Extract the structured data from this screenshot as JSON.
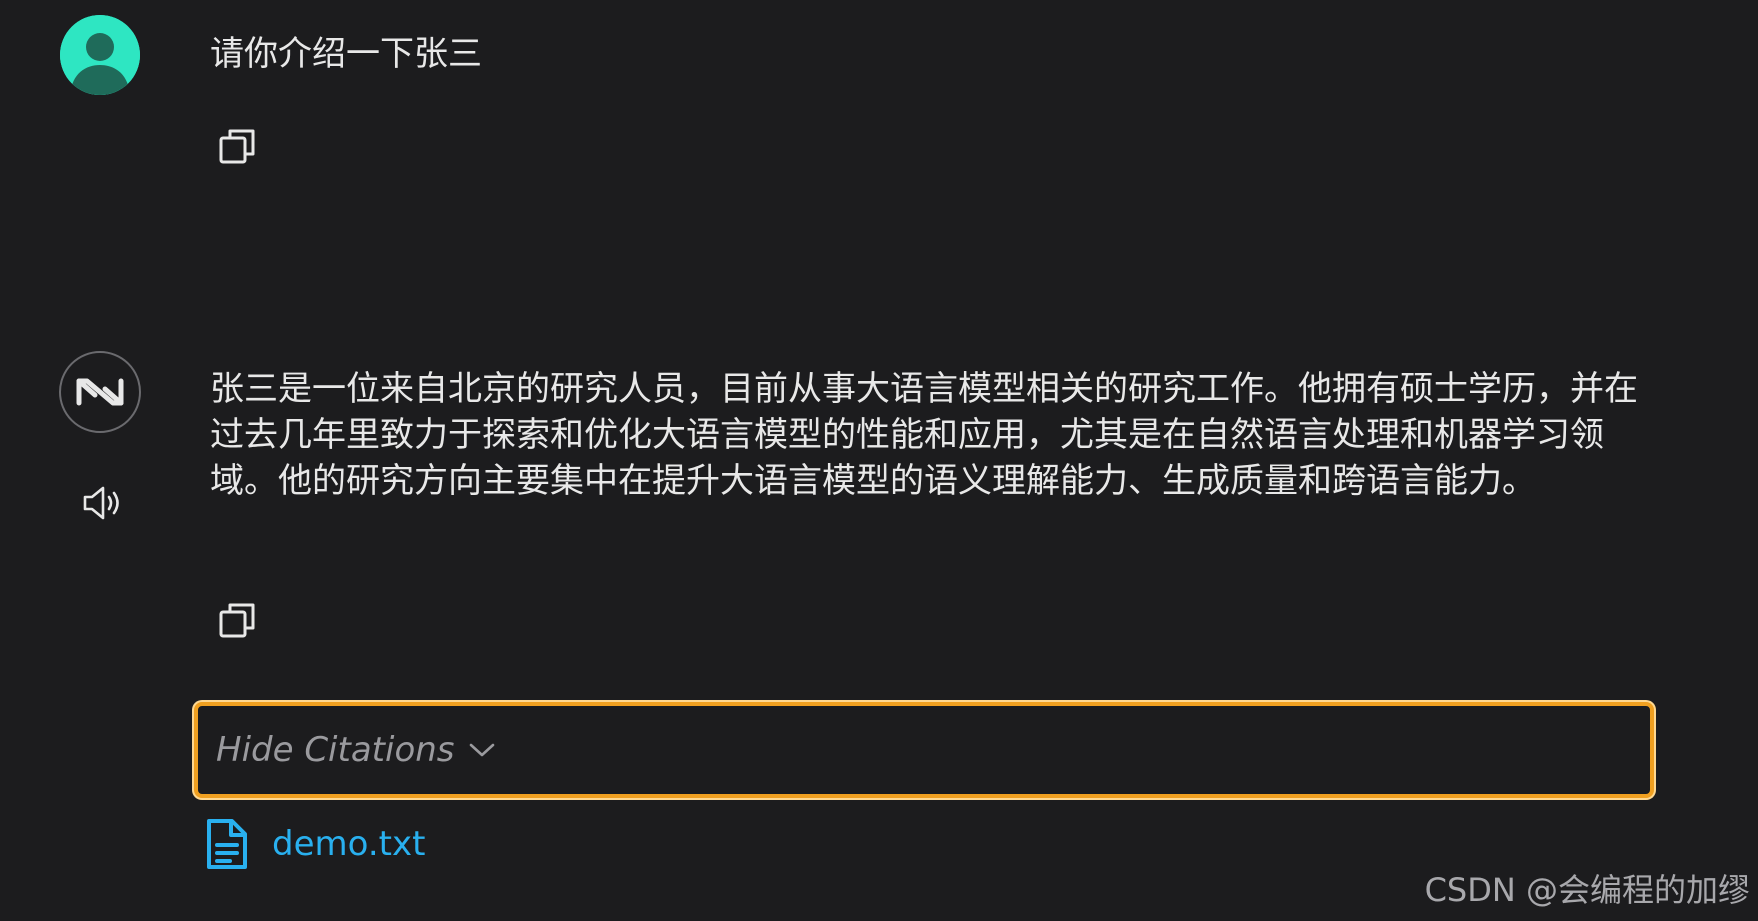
{
  "colors": {
    "background": "#1c1c1e",
    "text": "#e8e8e8",
    "user_avatar": "#2ee6c2",
    "focus_border": "#f0a020",
    "link": "#29b0ef",
    "muted": "#9a9a9e"
  },
  "user_message": {
    "avatar_icon": "user-avatar-icon",
    "text": "请你介绍一下张三",
    "copy_icon": "copy-icon"
  },
  "assistant_message": {
    "avatar_icon": "assistant-logo-icon",
    "speaker_icon": "speaker-icon",
    "text": "张三是一位来自北京的研究人员，目前从事大语言模型相关的研究工作。他拥有硕士学历，并在过去几年里致力于探索和优化大语言模型的性能和应用，尤其是在自然语言处理和机器学习领域。他的研究方向主要集中在提升大语言模型的语义理解能力、生成质量和跨语言能力。",
    "copy_icon": "copy-icon"
  },
  "citations": {
    "toggle_label": "Hide Citations",
    "chevron_icon": "chevron-down-icon",
    "items": [
      {
        "icon": "document-icon",
        "name": "demo.txt"
      }
    ]
  },
  "watermark": "CSDN @会编程的加缪"
}
